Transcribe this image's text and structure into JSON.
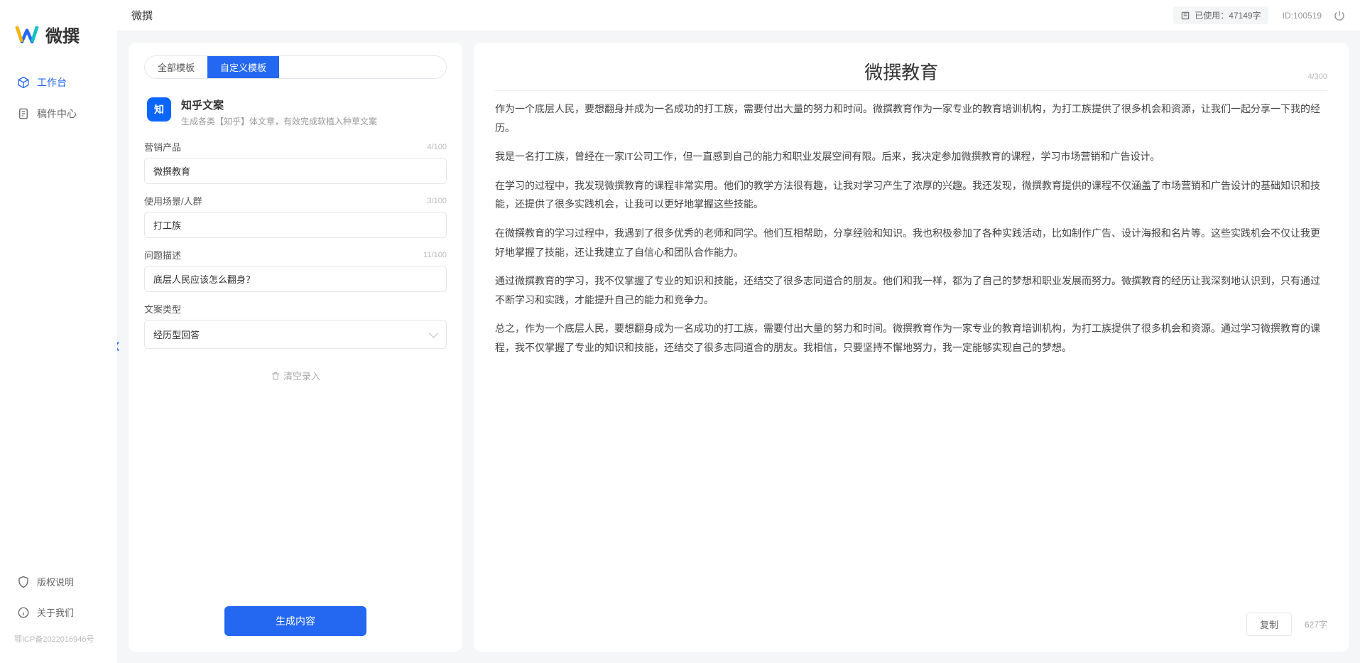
{
  "brand": {
    "name": "微撰"
  },
  "topbar": {
    "title": "微撰",
    "usage_prefix": "已使用：",
    "usage_value": "47149字",
    "userid": "ID:100519"
  },
  "sidebar": {
    "items": [
      {
        "label": "工作台",
        "active": true,
        "icon": "cube"
      },
      {
        "label": "稿件中心",
        "active": false,
        "icon": "doc"
      }
    ],
    "bottom": [
      {
        "label": "版权说明",
        "icon": "shield"
      },
      {
        "label": "关于我们",
        "icon": "info"
      }
    ],
    "icp": "鄂ICP备2022016946号"
  },
  "tabs": {
    "all": "全部模板",
    "custom": "自定义模板"
  },
  "template": {
    "icon_text": "知",
    "title": "知乎文案",
    "desc": "生成各类【知乎】体文章，有效完成软植入种草文案"
  },
  "form": {
    "product": {
      "label": "营销产品",
      "value": "微撰教育",
      "counter": "4/100"
    },
    "scene": {
      "label": "使用场景/人群",
      "value": "打工族",
      "counter": "3/100"
    },
    "problem": {
      "label": "问题描述",
      "value": "底层人民应该怎么翻身？",
      "counter": "11/100"
    },
    "type": {
      "label": "文案类型",
      "value": "经历型回答"
    },
    "clear": "清空录入",
    "generate": "生成内容"
  },
  "output": {
    "title": "微撰教育",
    "title_counter": "4/300",
    "paragraphs": [
      "作为一个底层人民，要想翻身并成为一名成功的打工族，需要付出大量的努力和时间。微撰教育作为一家专业的教育培训机构，为打工族提供了很多机会和资源，让我们一起分享一下我的经历。",
      "我是一名打工族，曾经在一家IT公司工作，但一直感到自己的能力和职业发展空间有限。后来，我决定参加微撰教育的课程，学习市场营销和广告设计。",
      "在学习的过程中，我发现微撰教育的课程非常实用。他们的教学方法很有趣，让我对学习产生了浓厚的兴趣。我还发现，微撰教育提供的课程不仅涵盖了市场营销和广告设计的基础知识和技能，还提供了很多实践机会，让我可以更好地掌握这些技能。",
      "在微撰教育的学习过程中，我遇到了很多优秀的老师和同学。他们互相帮助，分享经验和知识。我也积极参加了各种实践活动，比如制作广告、设计海报和名片等。这些实践机会不仅让我更好地掌握了技能，还让我建立了自信心和团队合作能力。",
      "通过微撰教育的学习，我不仅掌握了专业的知识和技能，还结交了很多志同道合的朋友。他们和我一样，都为了自己的梦想和职业发展而努力。微撰教育的经历让我深刻地认识到，只有通过不断学习和实践，才能提升自己的能力和竞争力。",
      "总之，作为一个底层人民，要想翻身成为一名成功的打工族，需要付出大量的努力和时间。微撰教育作为一家专业的教育培训机构，为打工族提供了很多机会和资源。通过学习微撰教育的课程，我不仅掌握了专业的知识和技能，还结交了很多志同道合的朋友。我相信，只要坚持不懈地努力，我一定能够实现自己的梦想。"
    ],
    "copy": "复制",
    "char_count": "627字"
  }
}
